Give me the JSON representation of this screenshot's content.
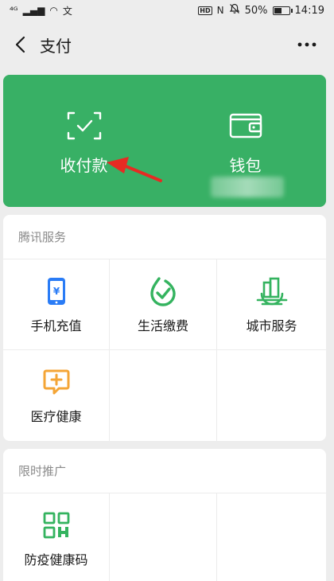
{
  "status_bar": {
    "left_glyphs": [
      "⁴ᴳ",
      "▂▄▆",
      "◠",
      "文"
    ],
    "hd": "HD",
    "nfc": "N",
    "battery_percent": "50%",
    "battery_level": 0.5,
    "time": "14:19"
  },
  "header": {
    "title": "支付",
    "more_label": "⋯"
  },
  "top_card": {
    "color": "#38b065",
    "items": [
      {
        "label": "收付款",
        "icon": "scan-pay-icon"
      },
      {
        "label": "钱包",
        "icon": "wallet-icon"
      }
    ]
  },
  "sections": [
    {
      "title": "腾讯服务",
      "items": [
        {
          "label": "手机充值",
          "icon": "mobile-topup-icon",
          "color": "#2a7cf6"
        },
        {
          "label": "生活缴费",
          "icon": "utility-payment-icon",
          "color": "#34b35f"
        },
        {
          "label": "城市服务",
          "icon": "city-services-icon",
          "color": "#34b35f"
        },
        {
          "label": "医疗健康",
          "icon": "medical-health-icon",
          "color": "#f4a536"
        }
      ]
    },
    {
      "title": "限时推广",
      "items": [
        {
          "label": "防疫健康码",
          "icon": "health-qr-code-icon",
          "color": "#34b35f"
        }
      ]
    }
  ]
}
